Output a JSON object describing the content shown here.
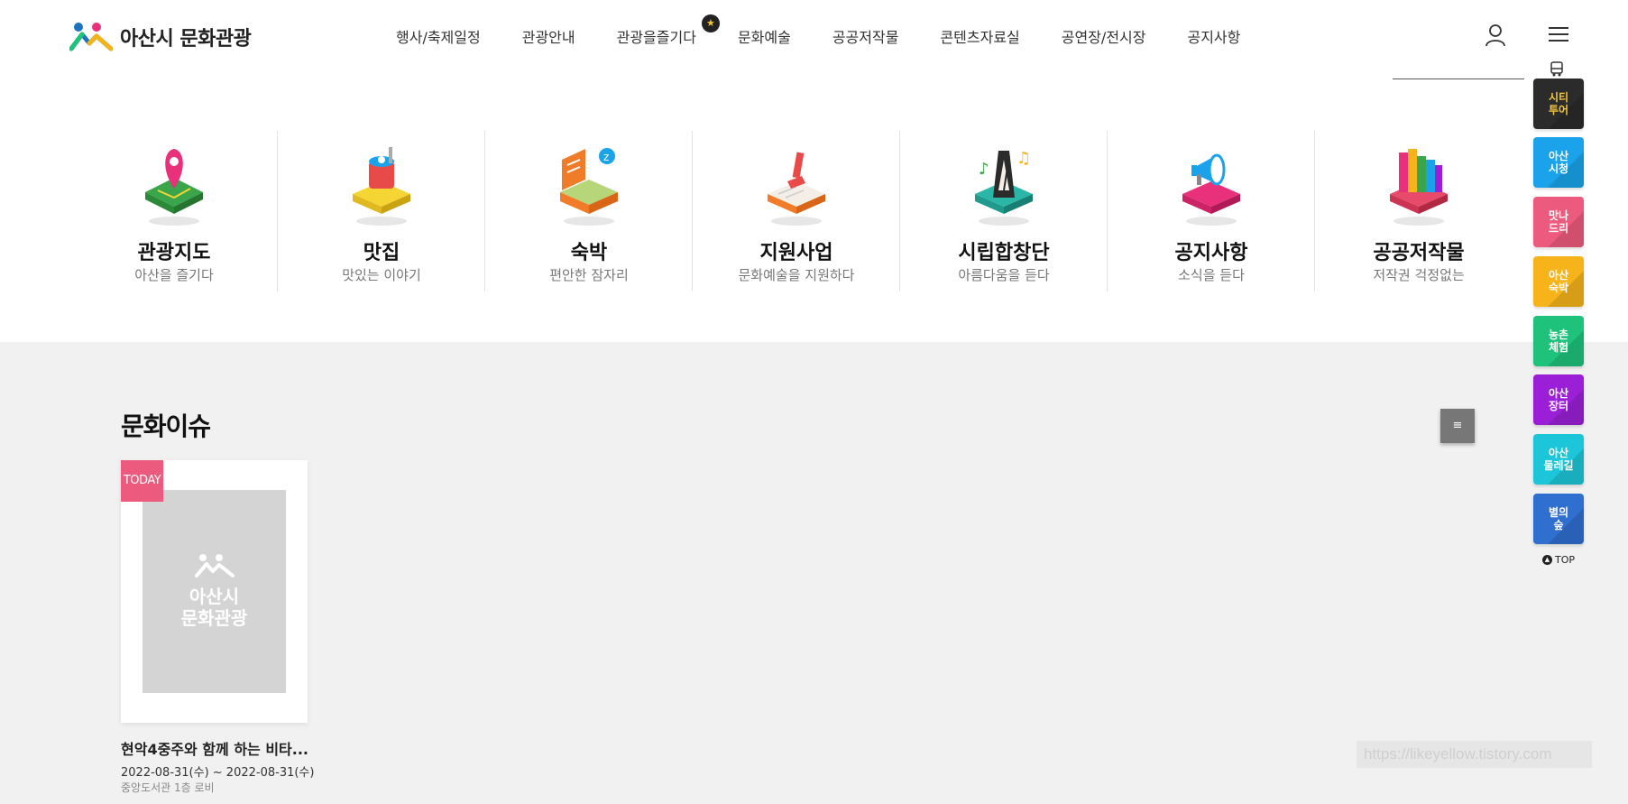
{
  "header": {
    "logo_text": "아산시 문화관광",
    "nav": [
      {
        "label": "행사/축제일정"
      },
      {
        "label": "관광안내"
      },
      {
        "label": "관광을즐기다",
        "badge": "★"
      },
      {
        "label": "문화예술"
      },
      {
        "label": "공공저작물"
      },
      {
        "label": "콘텐츠자료실"
      },
      {
        "label": "공연장/전시장"
      },
      {
        "label": "공지사항"
      }
    ],
    "user_icon": "user-icon",
    "menu_icon": "hamburger-icon"
  },
  "quick_links": [
    {
      "title": "관광지도",
      "sub": "아산을 즐기다",
      "icon": "map-pin-icon",
      "color": "#e8317a"
    },
    {
      "title": "맛집",
      "sub": "맛있는 이야기",
      "icon": "food-icon",
      "color": "#f5d533"
    },
    {
      "title": "숙박",
      "sub": "편안한 잠자리",
      "icon": "bed-icon",
      "color": "#f07b28"
    },
    {
      "title": "지원사업",
      "sub": "문화예술을 지원하다",
      "icon": "book-icon",
      "color": "#e84a4a"
    },
    {
      "title": "시립합창단",
      "sub": "아름다움을 듣다",
      "icon": "metronome-icon",
      "color": "#2bb7a8"
    },
    {
      "title": "공지사항",
      "sub": "소식을 듣다",
      "icon": "megaphone-icon",
      "color": "#e8317a"
    },
    {
      "title": "공공저작물",
      "sub": "저작권 걱정없는",
      "icon": "books-icon",
      "color": "#e84a6a"
    }
  ],
  "culture": {
    "title": "문화이슈",
    "more_icon": "≡",
    "card": {
      "badge": "TODAY",
      "placeholder_line1": "아산시",
      "placeholder_line2": "문화관광",
      "title": "현악4중주와 함께 하는 비타...",
      "date": "2022-08-31(수) ~ 2022-08-31(수)",
      "place": "중앙도서관 1층 로비"
    }
  },
  "watermark": "https://likeyellow.tistory.com",
  "sidebar": {
    "tiles": [
      {
        "label": "시티\n투어",
        "color": "#2b2b2b",
        "text_color": "#f6c63a"
      },
      {
        "label": "아산\n시청",
        "color": "#1aa3ea",
        "text_color": "#ffffff"
      },
      {
        "label": "맛나\n드리",
        "color": "#ec5b7d",
        "text_color": "#ffffff"
      },
      {
        "label": "아산\n숙박",
        "color": "#f6b31a",
        "text_color": "#ffffff"
      },
      {
        "label": "농촌\n체험",
        "color": "#1ec27a",
        "text_color": "#ffffff"
      },
      {
        "label": "아산\n장터",
        "color": "#9b1fd6",
        "text_color": "#ffffff"
      },
      {
        "label": "아산\n둘레길",
        "color": "#1cc6d8",
        "text_color": "#ffffff"
      },
      {
        "label": "별의\n숲",
        "color": "#2f6fd0",
        "text_color": "#ffffff"
      }
    ],
    "top_label": "TOP"
  }
}
